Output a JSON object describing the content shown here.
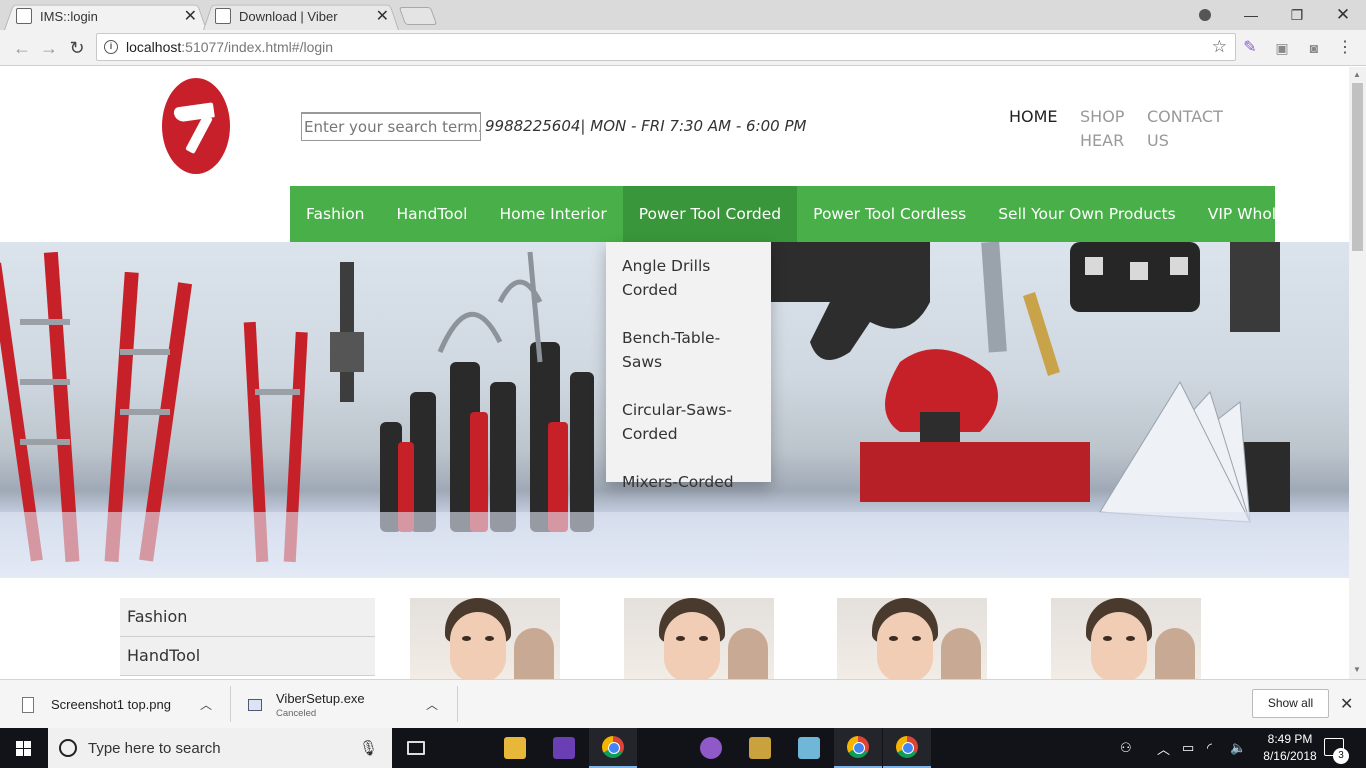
{
  "browser": {
    "tabs": [
      {
        "title": "IMS::login",
        "active": true
      },
      {
        "title": "Download | Viber",
        "active": false
      }
    ],
    "url_host": "localhost",
    "url_path": ":51077/index.html#/login"
  },
  "header": {
    "search_placeholder": "Enter your search term...",
    "contact_info": "9988225604| MON - FRI 7:30 AM - 6:00 PM",
    "top_links": [
      {
        "line1": "HOME",
        "line2": ""
      },
      {
        "line1": "SHOP",
        "line2": "HEAR"
      },
      {
        "line1": "CONTACT",
        "line2": "US"
      }
    ]
  },
  "main_nav": {
    "items": [
      "Fashion",
      "HandTool",
      "Home Interior",
      "Power Tool Corded",
      "Power Tool Cordless",
      "Sell Your Own Products",
      "VIP WholeSale"
    ],
    "active": "Power Tool Corded"
  },
  "dropdown": {
    "items": [
      {
        "line1": "Angle Drills",
        "line2": "Corded"
      },
      {
        "line1": "Bench-Table-Saws",
        "line2": ""
      },
      {
        "line1": "Circular-Saws-",
        "line2": "Corded"
      },
      {
        "line1": "Mixers-Corded",
        "line2": ""
      }
    ]
  },
  "side_menu": {
    "items": [
      "Fashion",
      "HandTool"
    ]
  },
  "downloads": {
    "items": [
      {
        "name": "Screenshot1 top.png",
        "status": ""
      },
      {
        "name": "ViberSetup.exe",
        "status": "Canceled"
      }
    ],
    "show_all": "Show all"
  },
  "taskbar": {
    "search_placeholder": "Type here to search",
    "time": "8:49 PM",
    "date": "8/16/2018",
    "notification_count": "3"
  },
  "colors": {
    "nav_green": "#49b049",
    "nav_active": "#3a963a",
    "logo_red": "#c8202a"
  }
}
